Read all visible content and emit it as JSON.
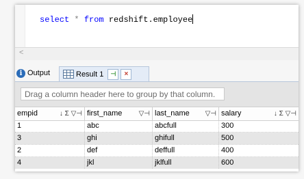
{
  "editor": {
    "code_tokens": {
      "kw1": "select",
      "star": "*",
      "kw2": "from",
      "rest": "redshift.employee"
    },
    "scroll_left_glyph": "<"
  },
  "tabs": {
    "output_label": "Output",
    "result_label": "Result 1",
    "pin_glyph": "⊣",
    "close_glyph": "×"
  },
  "grid": {
    "group_placeholder": "Drag a column header here to group by that column.",
    "columns": [
      {
        "label": "empid",
        "icons": "↓ Σ ▽⊣"
      },
      {
        "label": "first_name",
        "icons": "▽⊣"
      },
      {
        "label": "last_name",
        "icons": "▽⊣"
      },
      {
        "label": "salary",
        "icons": "↓ Σ ▽⊣"
      }
    ],
    "rows": [
      [
        "1",
        "abc",
        "abcfull",
        "300"
      ],
      [
        "3",
        "ghi",
        "ghifull",
        "500"
      ],
      [
        "2",
        "def",
        "deffull",
        "400"
      ],
      [
        "4",
        "jkl",
        "jklfull",
        "600"
      ]
    ]
  },
  "colors": {
    "keyword": "#0000ff",
    "tab_active_bg": "#e4ecf7",
    "info_icon": "#2b6cb8"
  }
}
